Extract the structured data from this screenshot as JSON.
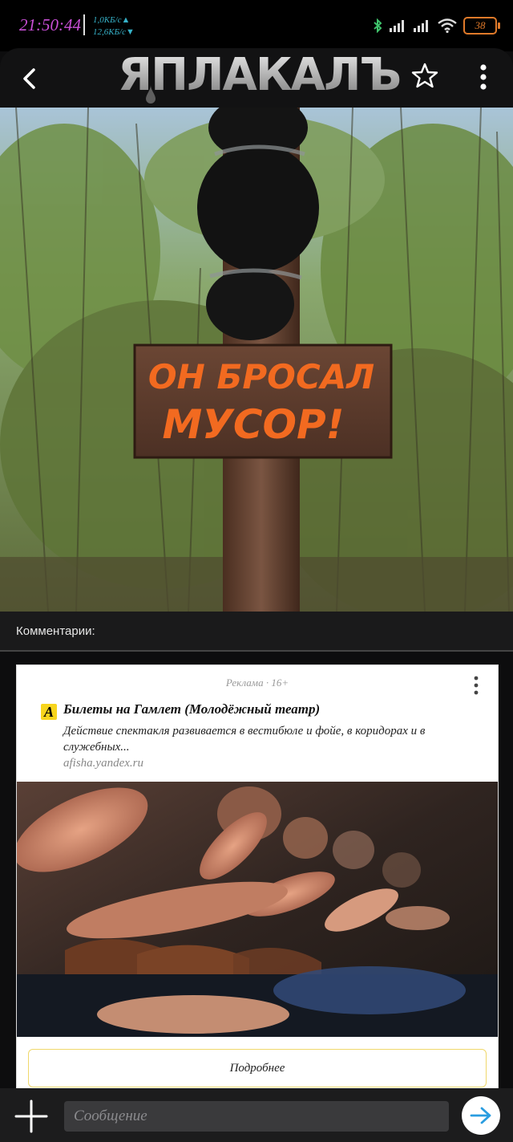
{
  "status_bar": {
    "time": "21:50:44",
    "upload_speed": "1,0КБ/с▲",
    "download_speed": "12,6КБ/с▼",
    "battery": "38",
    "icons": [
      "bluetooth-icon",
      "signal-icon",
      "signal-icon",
      "wifi-icon",
      "battery-icon"
    ]
  },
  "header": {
    "logo_text": "ЯПЛАКАЛЪ",
    "back_icon": "chevron-left-icon",
    "favorite_icon": "star-outline-icon",
    "menu_icon": "more-vertical-icon"
  },
  "post": {
    "sign_line_1": "ОН БРОСАЛ",
    "sign_line_2": "МУСОР!"
  },
  "comments": {
    "label": "Комментарии:"
  },
  "ad": {
    "tag": "Реклама · 16+",
    "logo_letter": "A",
    "title": "Билеты на Гамлет (Молодёжный театр)",
    "description": "Действие спектакля развивается в вестибюле и фойе, в коридорах и в служебных...",
    "domain": "afisha.yandex.ru",
    "cta_label": "Подробнее"
  },
  "compose": {
    "placeholder": "Сообщение",
    "value": "",
    "add_icon": "plus-icon",
    "send_icon": "arrow-right-icon"
  },
  "colors": {
    "accent_time": "#c94fd6",
    "speed": "#36b2c9",
    "battery": "#e07a2a",
    "sign_paint": "#f26a20",
    "ad_cta_border": "#f0d86b"
  }
}
